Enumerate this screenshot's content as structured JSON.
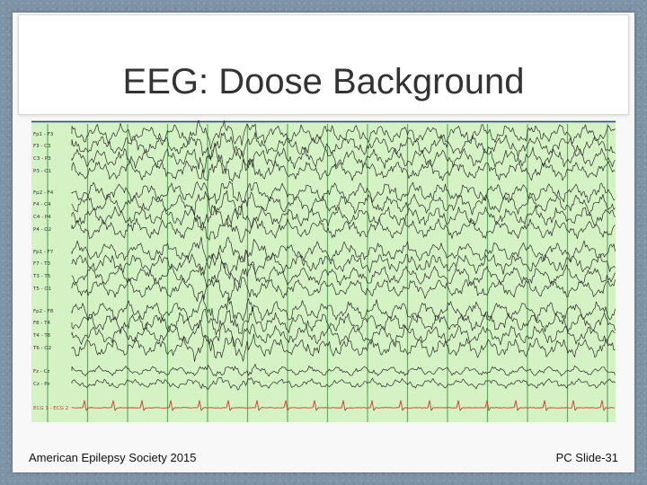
{
  "slide": {
    "title": "EEG: Doose Background",
    "footer_left": "American Epilepsy Society 2015",
    "footer_right": "PC Slide-31"
  },
  "eeg": {
    "channel_labels": [
      "Fp1 - F3",
      "F3 - C3",
      "C3 - P3",
      "P3 - O1",
      "Fp2 - F4",
      "F4 - C4",
      "C4 - P4",
      "P4 - O2",
      "Fp1 - F7",
      "F7 - T3",
      "T3 - T5",
      "T5 - O1",
      "Fp2 - F8",
      "F8 - T4",
      "T4 - T6",
      "T6 - O2",
      "Fz - Cz",
      "Cz - Pz",
      "ECG 1 - ECG 2"
    ],
    "colors": {
      "background": "#d4f2c4",
      "trace": "#2a2a2a",
      "ecg": "#d23a2a",
      "gridline": "#4aa34a",
      "marker": "#2b3fb8"
    }
  }
}
